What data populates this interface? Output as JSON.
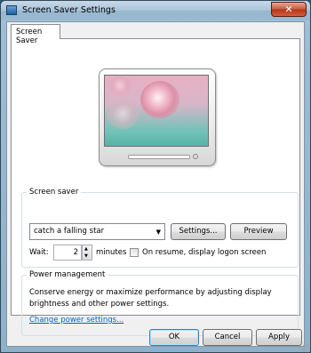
{
  "window": {
    "title": "Screen Saver Settings",
    "close_glyph": "✕",
    "app_icon": "monitor-icon"
  },
  "tabs": [
    {
      "label": "Screen Saver",
      "selected": true
    }
  ],
  "preview": {
    "monitor_icon": "monitor-preview"
  },
  "screen_saver": {
    "group_label": "Screen saver",
    "selected": "catch a falling star",
    "dropdown_arrow": "▼",
    "settings_label": "Settings...",
    "preview_label": "Preview",
    "wait_label": "Wait:",
    "wait_value": "2",
    "spin_up": "▲",
    "spin_down": "▼",
    "minutes_label": "minutes",
    "resume_label": "On resume, display logon screen",
    "resume_checked": false
  },
  "power": {
    "group_label": "Power management",
    "description": "Conserve energy or maximize performance by adjusting display brightness and other power settings.",
    "link": "Change power settings..."
  },
  "buttons": {
    "ok": "OK",
    "cancel": "Cancel",
    "apply": "Apply"
  },
  "colors": {
    "link": "#0066cc",
    "close_button": "#c75a3c"
  }
}
